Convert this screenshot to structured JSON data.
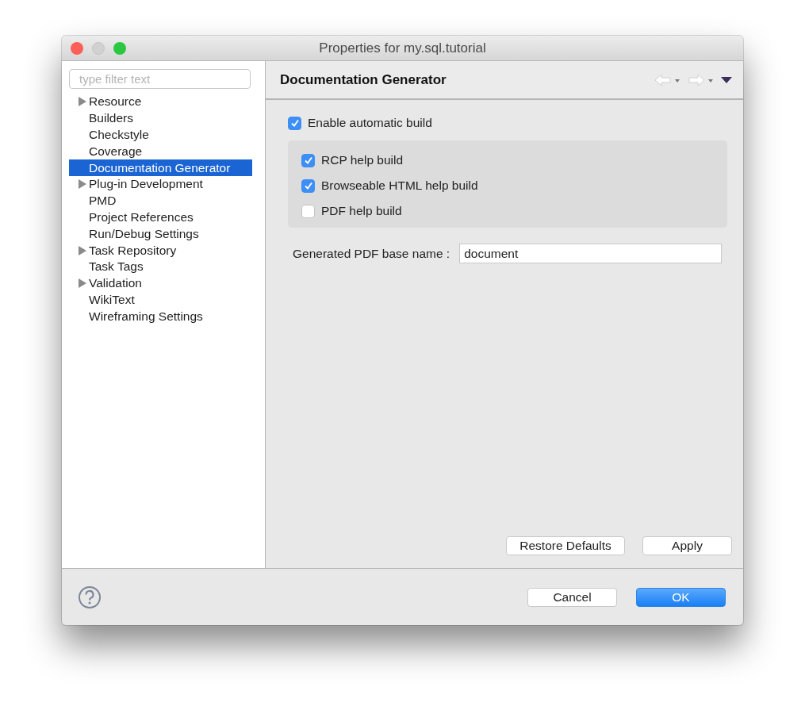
{
  "window": {
    "title": "Properties for my.sql.tutorial"
  },
  "sidebar": {
    "filter": {
      "placeholder": "type filter text"
    },
    "items": [
      {
        "label": "Resource",
        "kind": "group",
        "selected": false
      },
      {
        "label": "Builders",
        "kind": "leaf",
        "selected": false
      },
      {
        "label": "Checkstyle",
        "kind": "leaf",
        "selected": false
      },
      {
        "label": "Coverage",
        "kind": "leaf",
        "selected": false
      },
      {
        "label": "Documentation Generator",
        "kind": "leaf",
        "selected": true
      },
      {
        "label": "Plug-in Development",
        "kind": "group",
        "selected": false
      },
      {
        "label": "PMD",
        "kind": "leaf",
        "selected": false
      },
      {
        "label": "Project References",
        "kind": "leaf",
        "selected": false
      },
      {
        "label": "Run/Debug Settings",
        "kind": "leaf",
        "selected": false
      },
      {
        "label": "Task Repository",
        "kind": "group",
        "selected": false
      },
      {
        "label": "Task Tags",
        "kind": "leaf",
        "selected": false
      },
      {
        "label": "Validation",
        "kind": "group",
        "selected": false
      },
      {
        "label": "WikiText",
        "kind": "leaf",
        "selected": false
      },
      {
        "label": "Wireframing Settings",
        "kind": "leaf",
        "selected": false
      }
    ]
  },
  "page": {
    "title": "Documentation Generator",
    "enable": {
      "label": "Enable automatic build",
      "checked": true
    },
    "options": [
      {
        "label": "RCP help build",
        "checked": true
      },
      {
        "label": "Browseable HTML help build",
        "checked": true
      },
      {
        "label": "PDF help build",
        "checked": false
      }
    ],
    "base_name": {
      "label": "Generated PDF base name :",
      "value": "document"
    },
    "buttons": [
      "Restore Defaults",
      "Apply"
    ]
  },
  "footer": {
    "buttons": [
      {
        "label": "Cancel",
        "default": false
      },
      {
        "label": "OK",
        "default": true
      }
    ]
  }
}
